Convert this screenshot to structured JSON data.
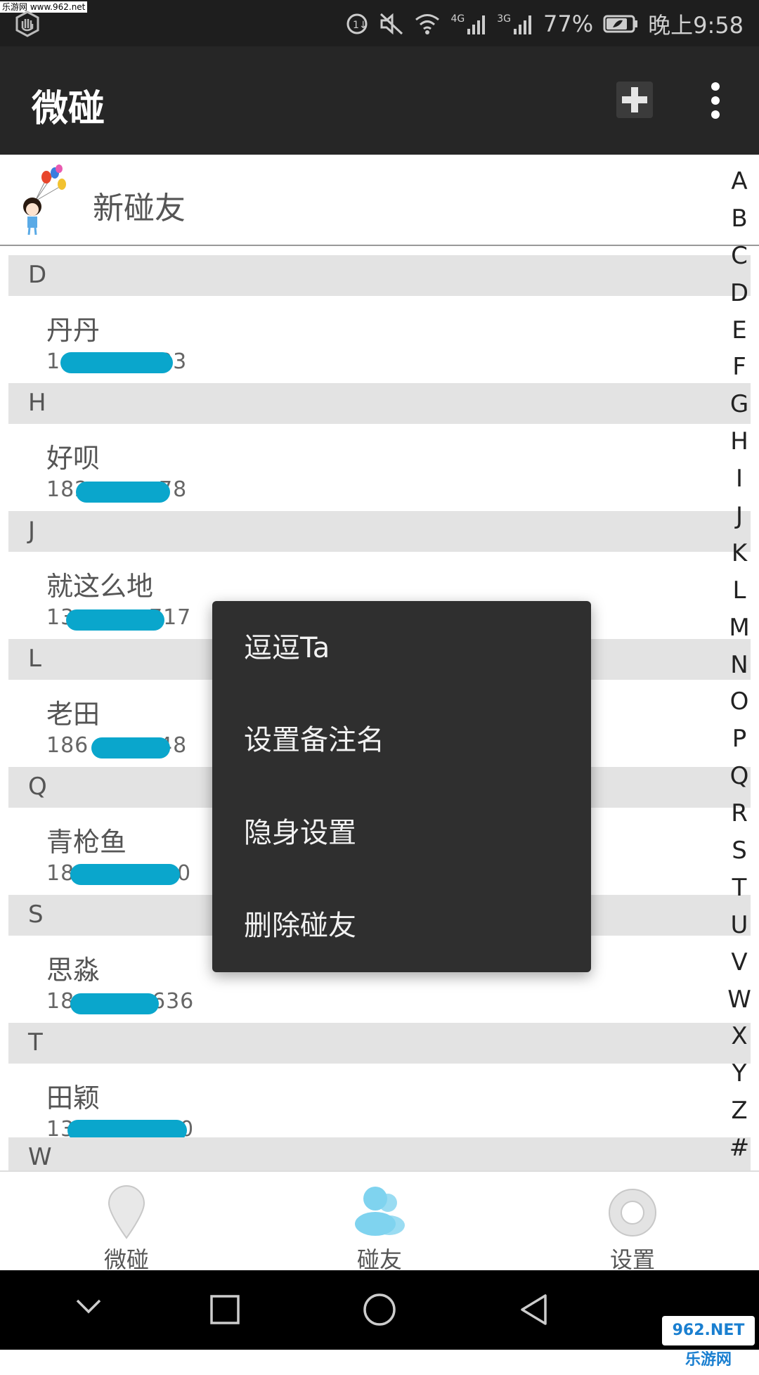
{
  "status_bar": {
    "watermark": "乐游网 www.962.net",
    "network_1": "4G",
    "network_2": "3G",
    "battery": "77%",
    "time": "晚上9:58"
  },
  "app_bar": {
    "title": "微碰",
    "add_icon": "plus-icon",
    "more_icon": "overflow-menu-icon"
  },
  "new_friends": {
    "label": "新碰友",
    "avatar_icon": "balloon-girl-avatar"
  },
  "sections": [
    {
      "letter": "D",
      "contacts": [
        {
          "name": "丹丹",
          "phone_start": "1",
          "phone_end": "33"
        }
      ]
    },
    {
      "letter": "H",
      "contacts": [
        {
          "name": "好呗",
          "phone_start": "182",
          "phone_end": "78"
        }
      ]
    },
    {
      "letter": "J",
      "contacts": [
        {
          "name": "就这么地",
          "phone_start": "13",
          "phone_end": "717"
        }
      ]
    },
    {
      "letter": "L",
      "contacts": [
        {
          "name": "老田",
          "phone_start": "186",
          "phone_end": "48"
        }
      ]
    },
    {
      "letter": "Q",
      "contacts": [
        {
          "name": "青枪鱼",
          "phone_start": "18",
          "phone_end": "0"
        }
      ]
    },
    {
      "letter": "S",
      "contacts": [
        {
          "name": "思淼",
          "phone_start": "18",
          "phone_end": "636"
        }
      ]
    },
    {
      "letter": "T",
      "contacts": [
        {
          "name": "田颖",
          "phone_start": "13",
          "phone_end": "0"
        }
      ]
    },
    {
      "letter": "W",
      "contacts": []
    }
  ],
  "index_letters": [
    "A",
    "B",
    "C",
    "D",
    "E",
    "F",
    "G",
    "H",
    "I",
    "J",
    "K",
    "L",
    "M",
    "N",
    "O",
    "P",
    "Q",
    "R",
    "S",
    "T",
    "U",
    "V",
    "W",
    "X",
    "Y",
    "Z",
    "#"
  ],
  "context_menu": {
    "items": [
      "逗逗Ta",
      "设置备注名",
      "隐身设置",
      "删除碰友"
    ]
  },
  "tabs": [
    {
      "label": "微碰",
      "icon": "location-pin-icon",
      "selected": false
    },
    {
      "label": "碰友",
      "icon": "friends-icon",
      "selected": true
    },
    {
      "label": "设置",
      "icon": "settings-ring-icon",
      "selected": false
    }
  ],
  "colors": {
    "app_bar": "#262626",
    "section_header": "#e3e3e3",
    "redaction": "#0aa6cc",
    "selected_tab": "#7fd3ef",
    "menu_bg": "#2f2f2f"
  },
  "nav_bar": {
    "logo_text": "962.NET 乐游网"
  }
}
